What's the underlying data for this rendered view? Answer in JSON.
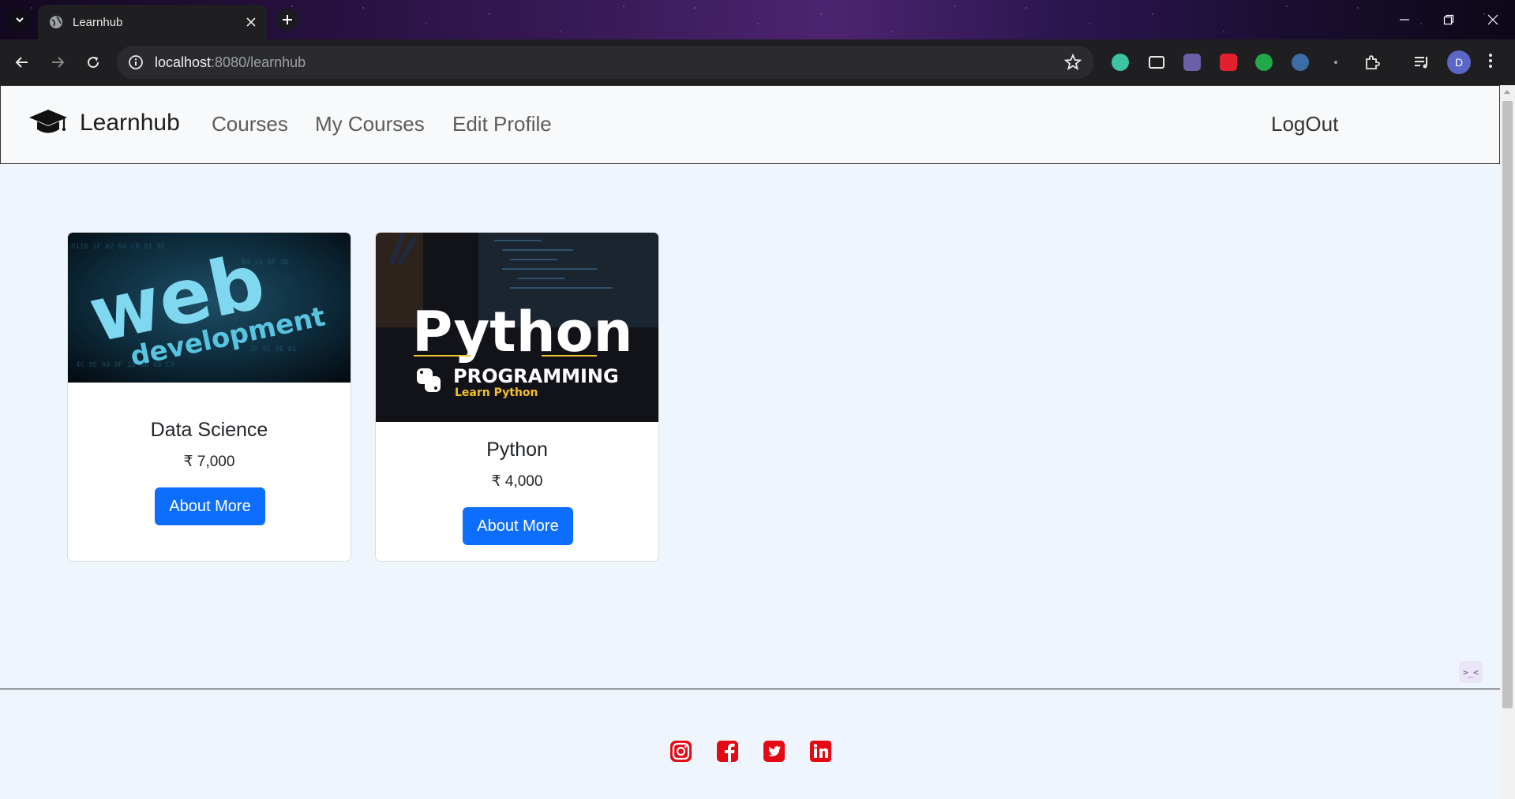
{
  "browser": {
    "tab_title": "Learnhub",
    "url_host": "localhost",
    "url_rest": ":8080/learnhub",
    "profile_initial": "D"
  },
  "navbar": {
    "brand": "Learnhub",
    "links": [
      "Courses",
      "My Courses",
      "Edit Profile"
    ],
    "logout": "LogOut"
  },
  "courses": [
    {
      "title": "Data Science",
      "price": "₹ 7,000",
      "button": "About More",
      "image_text_1": "web",
      "image_text_2": "development"
    },
    {
      "title": "Python",
      "price": "₹ 4,000",
      "button": "About More",
      "image_text_1": "Python",
      "image_text_2": "PROGRAMMING",
      "image_text_3": "Learn Python"
    }
  ],
  "footer": {
    "icons": [
      "instagram-icon",
      "facebook-icon",
      "twitter-icon",
      "linkedin-icon"
    ],
    "icon_color": "#e50914"
  },
  "colors": {
    "primary_button": "#0d6efd",
    "page_bg": "#eef5fd",
    "navbar_bg": "#f8f9fa"
  },
  "widget_text": ">_<"
}
